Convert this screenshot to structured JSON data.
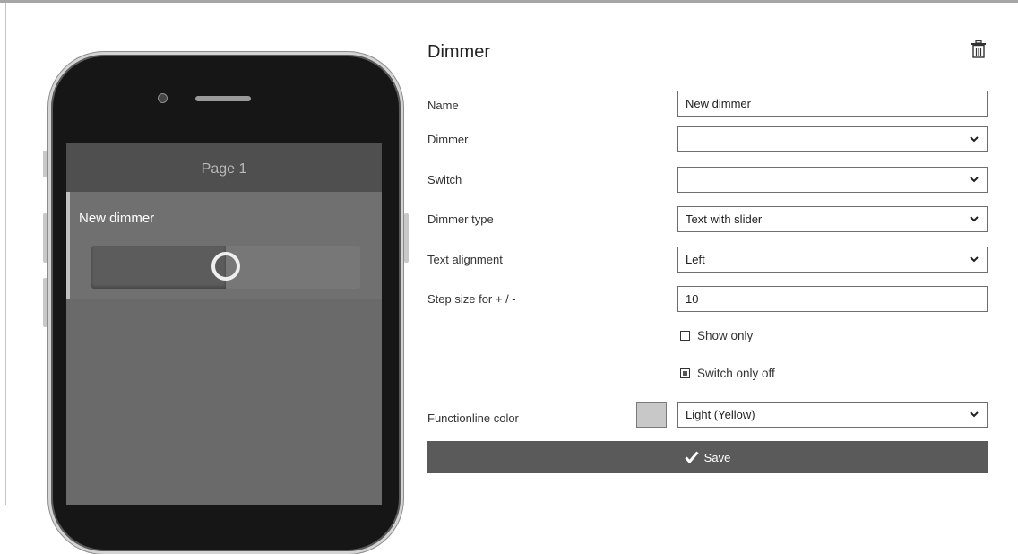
{
  "phone_preview": {
    "page_title": "Page 1",
    "widget_label": "New dimmer",
    "slider_level": 0.5
  },
  "form": {
    "title": "Dimmer",
    "fields": {
      "name": {
        "label": "Name",
        "value": "New dimmer"
      },
      "dimmer": {
        "label": "Dimmer",
        "value": ""
      },
      "switch": {
        "label": "Switch",
        "value": ""
      },
      "dimmer_type": {
        "label": "Dimmer type",
        "value": "Text with slider"
      },
      "text_alignment": {
        "label": "Text alignment",
        "value": "Left"
      },
      "step_size": {
        "label": "Step size for + / -",
        "value": "10"
      }
    },
    "checkboxes": {
      "show_only": {
        "label": "Show only",
        "checked": false
      },
      "switch_only_off": {
        "label": "Switch only off",
        "checked": true
      }
    },
    "functionline_color": {
      "label": "Functionline color",
      "value": "Light (Yellow)",
      "swatch": "#c8c8c8"
    },
    "save_label": "Save"
  },
  "icons": [
    "trash-icon",
    "chevron-down-icon",
    "checkmark-icon",
    "camera-icon"
  ]
}
